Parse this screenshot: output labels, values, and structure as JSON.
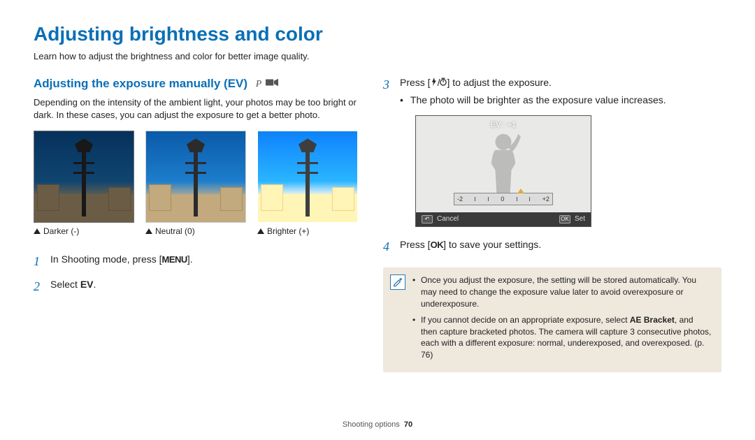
{
  "page": {
    "title": "Adjusting brightness and color",
    "intro": "Learn how to adjust the brightness and color for better image quality.",
    "footer_section": "Shooting options",
    "footer_page": "70"
  },
  "section": {
    "heading": "Adjusting the exposure manually (EV)",
    "mode_p": "P",
    "mode_video_icon": "video-mode-icon",
    "body": "Depending on the intensity of the ambient light, your photos may be too bright or dark. In these cases, you can adjust the exposure to get a better photo."
  },
  "examples": {
    "darker": "Darker (-)",
    "neutral": "Neutral (0)",
    "brighter": "Brighter (+)"
  },
  "steps_left": {
    "s1_pre": "In Shooting mode, press [",
    "s1_menu": "MENU",
    "s1_post": "].",
    "s2_pre": "Select ",
    "s2_ev": "EV",
    "s2_post": "."
  },
  "steps_right": {
    "s3_pre": "Press [",
    "s3_mid": "/",
    "s3_post": "] to adjust the exposure.",
    "s3_bullet": "The photo will be brighter as the exposure value increases.",
    "s4_pre": "Press [",
    "s4_ok": "OK",
    "s4_post": "] to save your settings."
  },
  "lcd": {
    "ev_label": "EV : +1",
    "scale_min": "-2",
    "scale_mid": "0",
    "scale_max": "+2",
    "cancel": "Cancel",
    "set": "Set"
  },
  "notes": {
    "icon_glyph": "✎",
    "n1": "Once you adjust the exposure, the setting will be stored automatically. You may need to change the exposure value later to avoid overexposure or underexposure.",
    "n2_a": "If you cannot decide on an appropriate exposure, select ",
    "n2_b": "AE Bracket",
    "n2_c": ", and then capture bracketed photos. The camera will capture 3 consecutive photos, each with a different exposure: normal, underexposed, and overexposed. (p. 76)"
  }
}
